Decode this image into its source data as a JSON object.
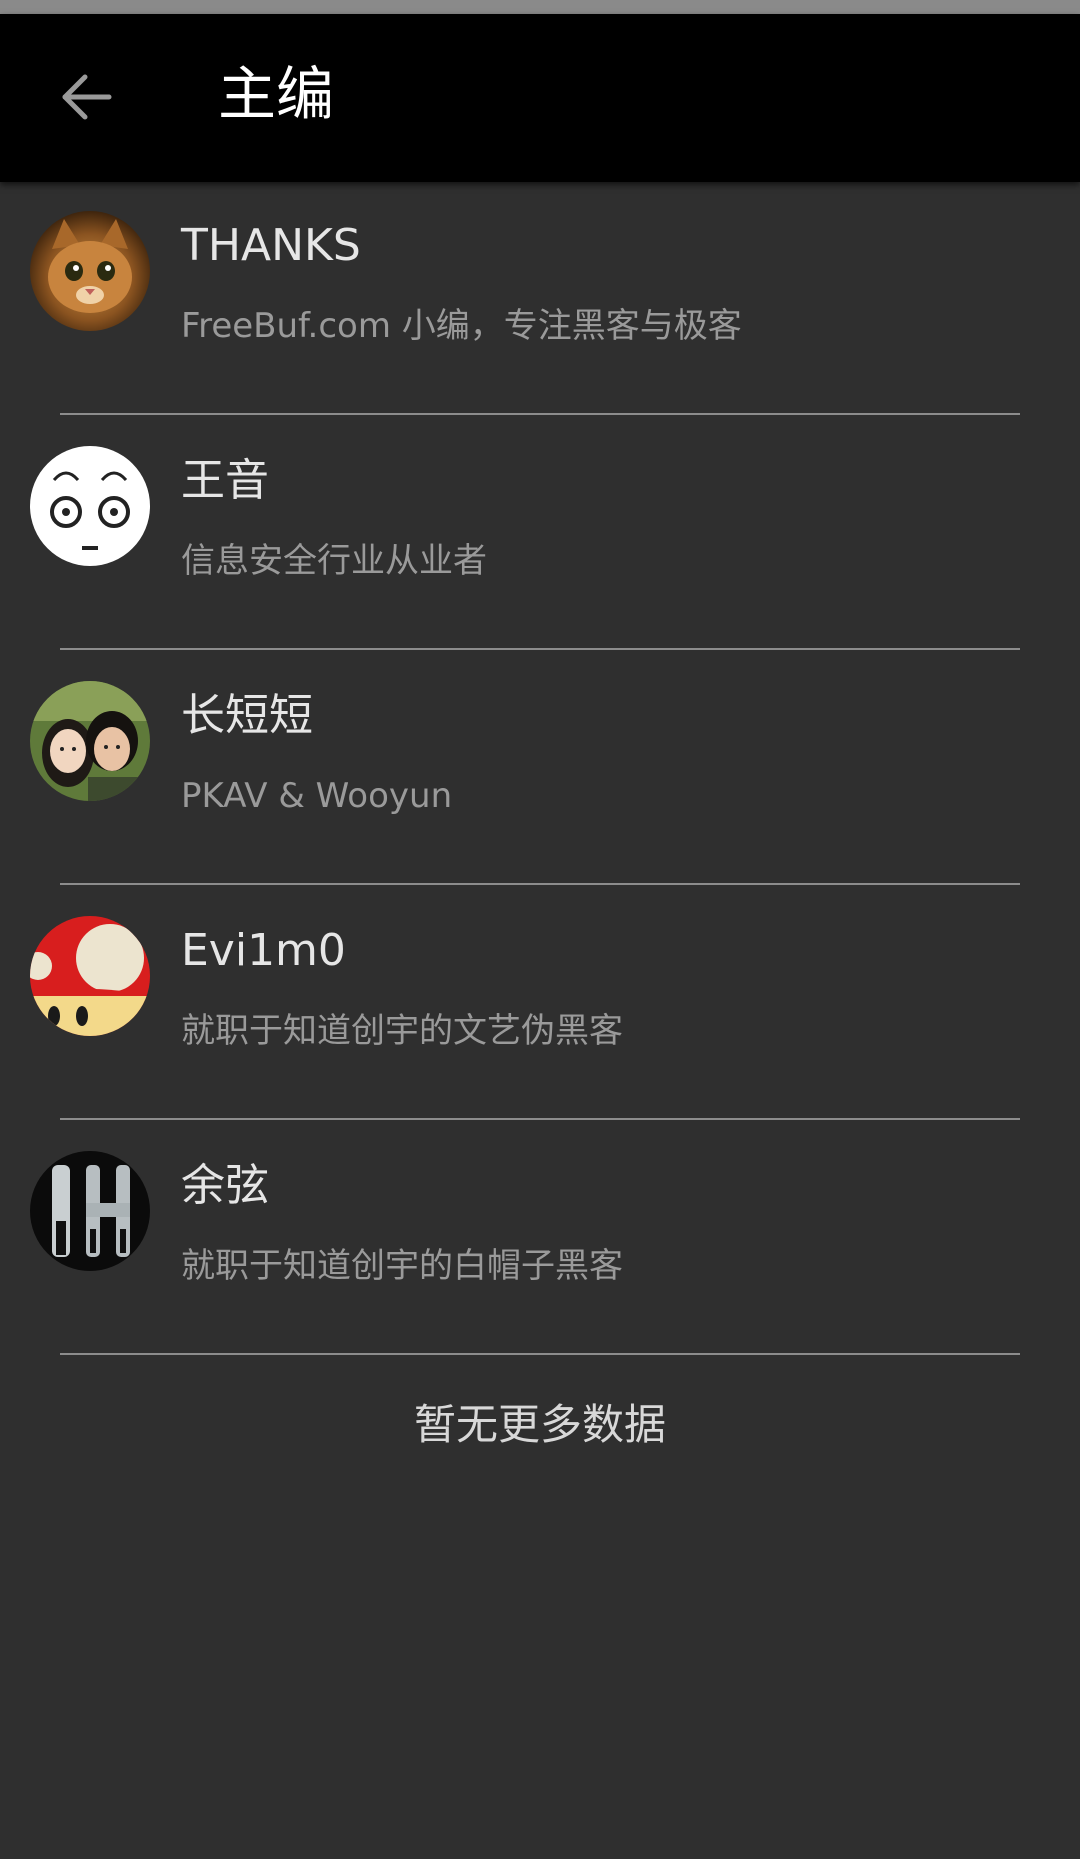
{
  "header": {
    "title": "主编",
    "back_icon": "arrow-left-icon"
  },
  "editors": [
    {
      "name": "THANKS",
      "description": "FreeBuf.com 小编，专注黑客与极客",
      "avatar": "cat-photo-avatar"
    },
    {
      "name": "王音",
      "description": "信息安全行业从业者",
      "avatar": "face-drawing-avatar"
    },
    {
      "name": "长短短",
      "description": "PKAV & Wooyun",
      "avatar": "couple-photo-avatar"
    },
    {
      "name": "Evi1m0",
      "description": "就职于知道创宇的文艺伪黑客",
      "avatar": "mushroom-avatar"
    },
    {
      "name": "余弦",
      "description": "就职于知道创宇的白帽子黑客",
      "avatar": "dark-logo-avatar"
    }
  ],
  "footer": {
    "no_more_text": "暂无更多数据"
  },
  "colors": {
    "background": "#2f2f2f",
    "app_bar": "#000000",
    "primary_text": "#e6e6e6",
    "secondary_text": "#9a9a9a"
  }
}
